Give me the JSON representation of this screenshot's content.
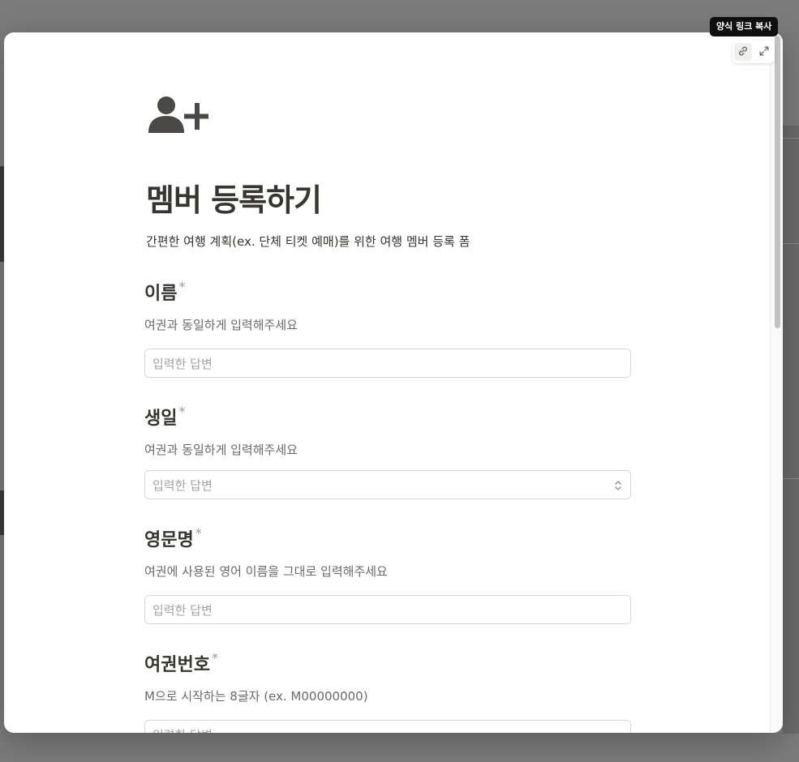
{
  "tooltip": {
    "text": "양식 링크 복사"
  },
  "corner_actions": {
    "link_icon": "link-icon",
    "expand_icon": "expand-icon"
  },
  "form": {
    "icon": "person-add-icon",
    "title": "멤버 등록하기",
    "description": "간편한 여행 계획(ex. 단체 티켓 예매)를 위한 여행 멤버 등록 폼",
    "required_mark": "*",
    "fields": [
      {
        "label": "이름",
        "help": "여권과 동일하게 입력해주세요",
        "placeholder": "입력한 답변"
      },
      {
        "label": "생일",
        "help": "여권과 동일하게 입력해주세요",
        "placeholder": "입력한 답변"
      },
      {
        "label": "영문명",
        "help": "여권에 사용된 영어 이름을 그대로 입력해주세요",
        "placeholder": "입력한 답변"
      },
      {
        "label": "여권번호",
        "help": "M으로 시작하는 8글자 (ex. M00000000)",
        "placeholder": "입력한 답변"
      }
    ]
  },
  "colors": {
    "overlay": "#7b7b7b",
    "text": "#37352f",
    "muted": "#6b6a67",
    "placeholder": "#a3a29e",
    "tooltip_bg": "#0f0f0f"
  }
}
